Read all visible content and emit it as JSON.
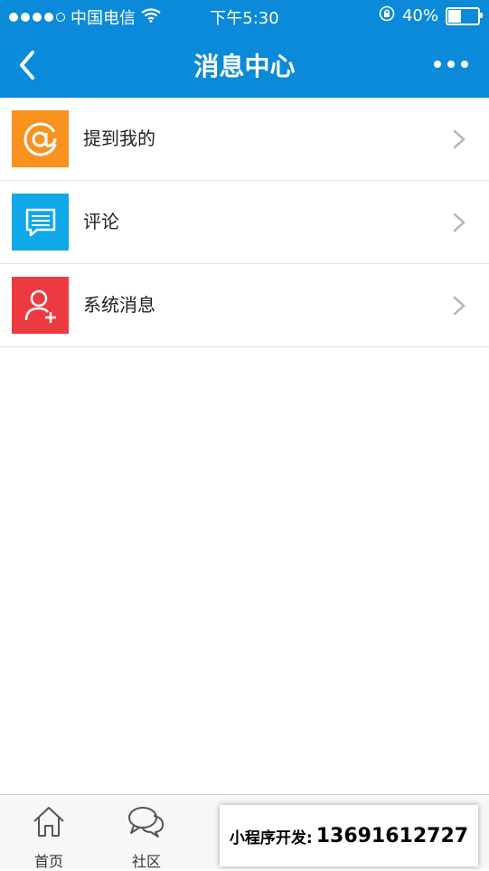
{
  "status_bar": {
    "carrier": "中国电信",
    "time": "下午5:30",
    "battery_percent": "40%",
    "battery_level": 0.4
  },
  "nav": {
    "title": "消息中心",
    "back_icon": "chevron-left-icon",
    "more_icon": "more-dots-icon"
  },
  "list": {
    "items": [
      {
        "label": "提到我的",
        "icon": "at-icon",
        "color": "#f7931e"
      },
      {
        "label": "评论",
        "icon": "comment-icon",
        "color": "#10a8e8"
      },
      {
        "label": "系统消息",
        "icon": "user-add-icon",
        "color": "#ec3a41"
      }
    ]
  },
  "tabbar": {
    "tabs": [
      {
        "label": "首页",
        "icon": "home-icon"
      },
      {
        "label": "社区",
        "icon": "chat-bubbles-icon"
      },
      {
        "label": "",
        "icon": ""
      },
      {
        "label": "",
        "icon": ""
      },
      {
        "label": "",
        "icon": ""
      }
    ],
    "active_color": "#0a8ad8"
  },
  "watermark": {
    "label": "小程序开发:",
    "number": "13691612727"
  },
  "colors": {
    "header_bg": "#0a8ad8"
  }
}
